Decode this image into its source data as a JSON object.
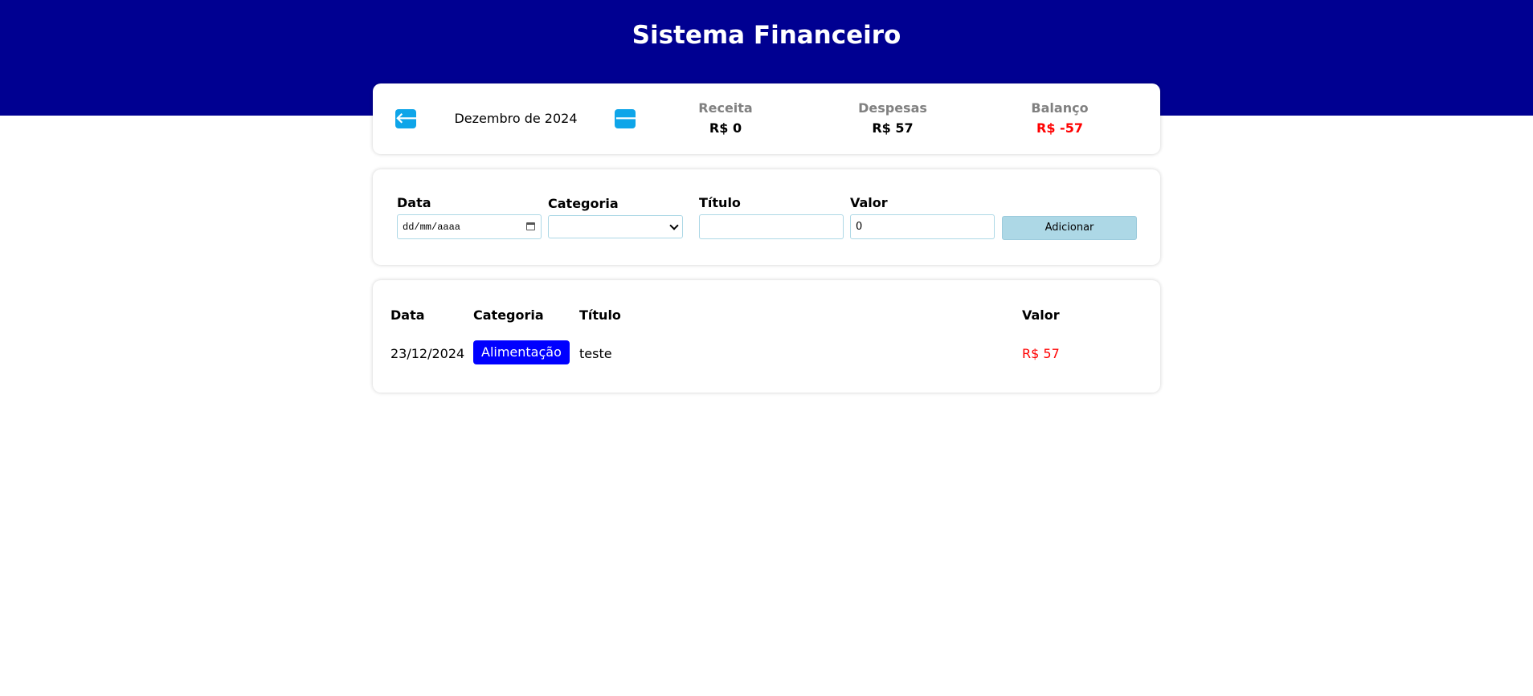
{
  "app": {
    "title": "Sistema Financeiro"
  },
  "info": {
    "month": "Dezembro de 2024",
    "prev_icon": "arrow-left-icon",
    "next_icon": "arrow-right-icon",
    "receita": {
      "title": "Receita",
      "value": "R$ 0"
    },
    "despesas": {
      "title": "Despesas",
      "value": "R$ 57"
    },
    "balanco": {
      "title": "Balanço",
      "value": "R$ -57",
      "color": "#ff0000"
    }
  },
  "form": {
    "data_label": "Data",
    "data_placeholder": "dd/mm/aaaa",
    "categoria_label": "Categoria",
    "categoria_value": "",
    "titulo_label": "Título",
    "titulo_value": "",
    "valor_label": "Valor",
    "valor_value": "0",
    "add_label": "Adicionar"
  },
  "table": {
    "headers": {
      "data": "Data",
      "categoria": "Categoria",
      "titulo": "Título",
      "valor": "Valor"
    },
    "rows": [
      {
        "data": "23/12/2024",
        "categoria": "Alimentação",
        "categoria_color": "#0000ff",
        "titulo": "teste",
        "valor": "R$ 57",
        "valor_color": "#ff0000"
      }
    ]
  }
}
